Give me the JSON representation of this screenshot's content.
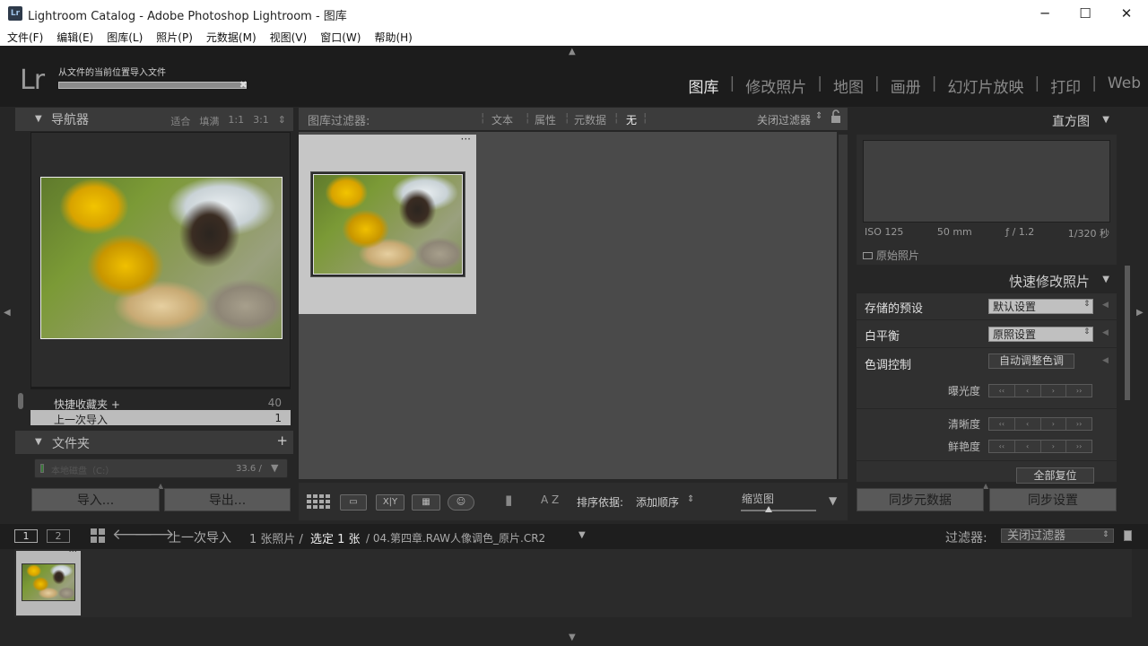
{
  "window": {
    "title": "Lightroom Catalog - Adobe Photoshop Lightroom - 图库",
    "icon_label": "Lr",
    "minimize": "─",
    "maximize": "☐",
    "close": "✕"
  },
  "menu": [
    "文件(F)",
    "编辑(E)",
    "图库(L)",
    "照片(P)",
    "元数据(M)",
    "视图(V)",
    "窗口(W)",
    "帮助(H)"
  ],
  "identity": {
    "logo": "Lr",
    "import_message": "从文件的当前位置导入文件",
    "import_progress": 0.95
  },
  "modules": [
    "图库",
    "修改照片",
    "地图",
    "画册",
    "幻灯片放映",
    "打印",
    "Web"
  ],
  "active_module": "图库",
  "navigator": {
    "title": "导航器",
    "options": [
      "适合",
      "填满",
      "1:1",
      "3:1"
    ]
  },
  "catalog": {
    "rows": [
      {
        "label": "快捷收藏夹 +",
        "count": "40"
      },
      {
        "label": "上一次导入",
        "count": "1"
      }
    ]
  },
  "folders": {
    "title": "文件夹",
    "add": "+",
    "volume": "本地磁盘（C:）",
    "volume_size": "33.6 /"
  },
  "left_buttons": {
    "import": "导入...",
    "export": "导出..."
  },
  "filter_bar": {
    "label": "图库过滤器:",
    "items": [
      "文本",
      "属性",
      "元数据",
      "无"
    ],
    "active": "无",
    "close_filter": "关闭过滤器"
  },
  "grid": {
    "cell_dots": "···"
  },
  "toolbar": {
    "sort_label": "排序依据:",
    "sort_value": "添加顺序",
    "thumb_label": "缩览图",
    "az": "A Z"
  },
  "histogram": {
    "title": "直方图",
    "exif": [
      "ISO 125",
      "50 mm",
      "ƒ / 1.2",
      "1/320 秒"
    ],
    "original": "原始照片"
  },
  "quick_develop": {
    "title": "快速修改照片",
    "saved_preset": {
      "label": "存储的预设",
      "value": "默认设置"
    },
    "white_balance": {
      "label": "白平衡",
      "value": "原照设置"
    },
    "tone": {
      "label": "色调控制",
      "auto": "自动调整色调"
    },
    "exposure": "曝光度",
    "clarity": "清晰度",
    "vibrance": "鲜艳度",
    "reset": "全部复位"
  },
  "right_buttons": {
    "sync_meta": "同步元数据",
    "sync_settings": "同步设置"
  },
  "filmstrip_bar": {
    "page1": "1",
    "page2": "2",
    "source": "上一次导入",
    "count": "1 张照片 /",
    "selected": "选定 1 张",
    "file": "/ 04.第四章.RAW人像调色_原片.CR2",
    "filter_label": "过滤器:",
    "filter_value": "关闭过滤器"
  }
}
